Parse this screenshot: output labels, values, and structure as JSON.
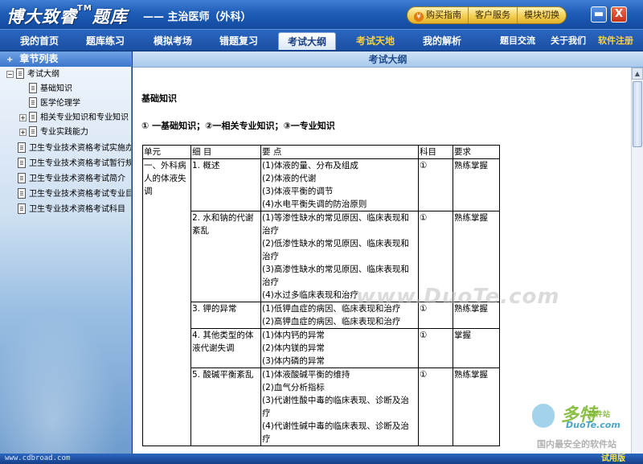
{
  "app": {
    "logo_text": "博大致睿",
    "logo_tm": "TM",
    "logo_suffix": "题库",
    "subtitle": "—— 主治医师（外科）"
  },
  "top_links": [
    {
      "label": "购买指南",
      "icon": "purchase-icon"
    },
    {
      "label": "客户服务"
    },
    {
      "label": "模块切换"
    }
  ],
  "window_controls": {
    "minimize": "▬",
    "close": "X"
  },
  "nav": {
    "items": [
      "我的首页",
      "题库练习",
      "模拟考场",
      "错题复习",
      "考试大纲",
      "考试天地",
      "我的解析",
      "题目交流",
      "关于我们",
      "软件注册"
    ],
    "active": "考试大纲"
  },
  "sidebar": {
    "header": "章节列表",
    "header_icon": "+",
    "tree": [
      {
        "label": "考试大纲",
        "expander": "−"
      },
      {
        "label": "基础知识"
      },
      {
        "label": "医学伦理学"
      },
      {
        "label": "相关专业知识和专业知识",
        "expander": "+"
      },
      {
        "label": "专业实践能力",
        "expander": "+"
      },
      {
        "label": "卫生专业技术资格考试实施办"
      },
      {
        "label": "卫生专业技术资格考试暂行规"
      },
      {
        "label": "卫生专业技术资格考试简介"
      },
      {
        "label": "卫生专业技术资格考试专业目"
      },
      {
        "label": "卫生专业技术资格考试科目"
      }
    ]
  },
  "content": {
    "header": "考试大纲",
    "doc_title": "基础知识",
    "legend": "① 一基础知识；②一相关专业知识；③一专业知识",
    "table": {
      "headers": [
        "单元",
        "细 目",
        "要 点",
        "科目",
        "要求"
      ],
      "unit": "一、外科病人的体液失调",
      "rows": [
        {
          "item": "1. 概述",
          "points": [
            "(1)体液的量、分布及组成",
            "(2)体液的代谢",
            "(3)体液平衡的调节",
            "(4)水电平衡失调的防治原则"
          ],
          "subject": "①",
          "req": "熟练掌握"
        },
        {
          "item": "2. 水和钠的代谢紊乱",
          "points": [
            "(1)等渗性缺水的常见原因、临床表现和治疗",
            "(2)低渗性缺水的常见原因、临床表现和治疗",
            "(3)高渗性缺水的常见原因、临床表现和治疗",
            "(4)水过多临床表现和治疗"
          ],
          "subject": "①",
          "req": "熟练掌握"
        },
        {
          "item": "3. 钾的异常",
          "points": [
            "(1)低钾血症的病因、临床表现和治疗",
            "(2)高钾血症的病因、临床表现和治疗"
          ],
          "subject": "①",
          "req": "熟练掌握"
        },
        {
          "item": "4. 其他类型的体液代谢失调",
          "points": [
            "(1)体内钙的异常",
            "(2)体内镁的异常",
            "(3)体内磷的异常"
          ],
          "subject": "①",
          "req": "掌握"
        },
        {
          "item": "5. 酸碱平衡紊乱",
          "points": [
            "(1)体液酸碱平衡的维持",
            "(2)血气分析指标",
            "(3)代谢性酸中毒的临床表现、诊断及治疗",
            "(4)代谢性碱中毒的临床表现、诊断及治疗"
          ],
          "subject": "①",
          "req": "熟练掌握"
        }
      ]
    }
  },
  "watermarks": {
    "center": "www.DuoTe.com",
    "logo_big": "多特",
    "logo_tag": "软件站",
    "logo_site": "DuoTe.com",
    "logo_slogan": "国内最安全的软件站"
  },
  "status": {
    "url": "www.cdbroad.com",
    "trial": "试用版"
  }
}
